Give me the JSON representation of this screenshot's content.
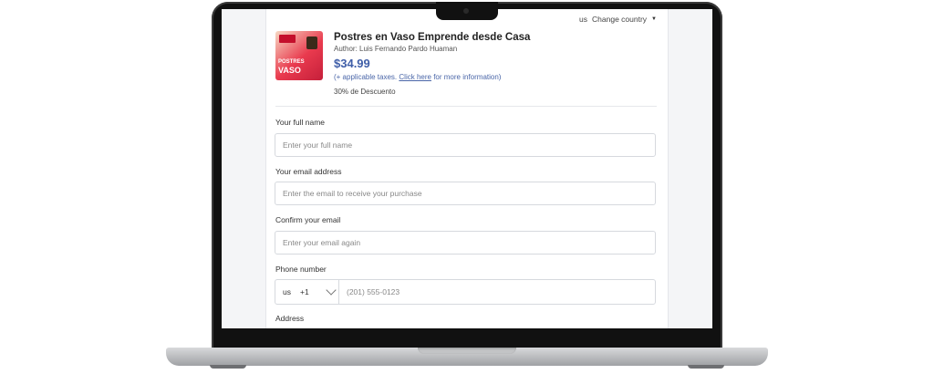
{
  "header": {
    "country_code": "us",
    "change_country": "Change country"
  },
  "product": {
    "title": "Postres en Vaso Emprende desde Casa",
    "author": "Author: Luis Fernando Pardo Huaman",
    "price": "$34.99",
    "taxes_prefix": "(+ applicable taxes.",
    "taxes_link": "Click here",
    "taxes_suffix": "for more information)",
    "discount": "30% de Descuento",
    "thumb_text_1": "POSTRES",
    "thumb_text_2": "VASO"
  },
  "form": {
    "full_name": {
      "label": "Your full name",
      "placeholder": "Enter your full name"
    },
    "email": {
      "label": "Your email address",
      "placeholder": "Enter the email to receive your purchase"
    },
    "confirm_email": {
      "label": "Confirm your email",
      "placeholder": "Enter your email again"
    },
    "phone": {
      "label": "Phone number",
      "country": "us",
      "dial_code": "+1",
      "placeholder": "(201) 555-0123"
    },
    "address": {
      "label": "Address"
    }
  },
  "colors": {
    "accent": "#3f5ea8",
    "link": "#4a66a8"
  }
}
